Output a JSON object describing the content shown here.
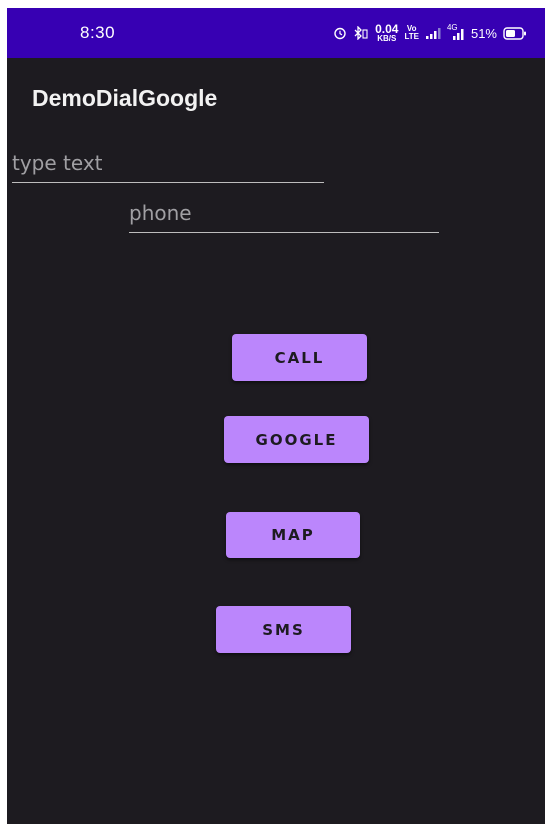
{
  "status_bar": {
    "time": "8:30",
    "net_speed_value": "0.04",
    "net_speed_unit": "KB/S",
    "volte_top": "Vo",
    "volte_bottom": "LTE",
    "network_type": "4G",
    "battery_percent": "51%",
    "colors": {
      "background": "#3700b3",
      "text": "#ffffff"
    },
    "icons": [
      "alarm-icon",
      "bluetooth-icon",
      "volte-icon",
      "signal-icon",
      "4g-signal-icon",
      "battery-icon"
    ]
  },
  "app": {
    "title": "DemoDialGoogle",
    "background": "#1d1b20"
  },
  "inputs": {
    "text": {
      "value": "",
      "placeholder": "type text"
    },
    "phone": {
      "value": "",
      "placeholder": "phone"
    }
  },
  "buttons": {
    "call": "CALL",
    "google": "GOOGLE",
    "map": "MAP",
    "sms": "SMS",
    "color": "#bb86fc"
  }
}
